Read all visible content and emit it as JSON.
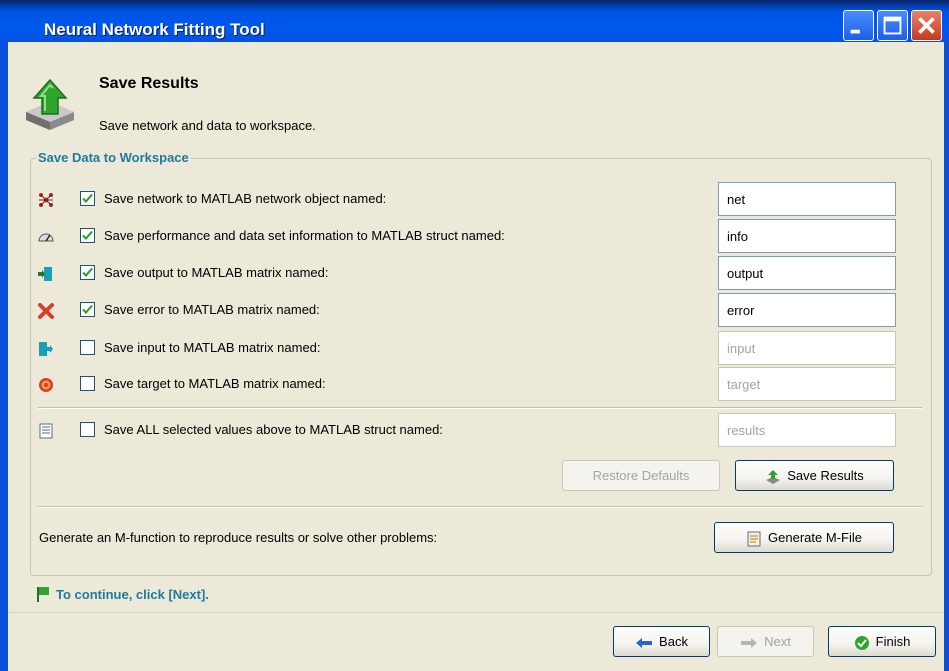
{
  "window": {
    "title": "Neural Network Fitting Tool"
  },
  "header": {
    "title": "Save Results",
    "subtitle": "Save network and data to workspace."
  },
  "group": {
    "legend": "Save Data to Workspace",
    "rows": [
      {
        "icon": "network-icon",
        "checked": true,
        "label": "Save network to MATLAB network object named:",
        "value": "net",
        "enabled": true
      },
      {
        "icon": "performance-icon",
        "checked": true,
        "label": "Save performance and data set information to MATLAB struct named:",
        "value": "info",
        "enabled": true
      },
      {
        "icon": "output-icon",
        "checked": true,
        "label": "Save output to MATLAB matrix named:",
        "value": "output",
        "enabled": true
      },
      {
        "icon": "error-icon",
        "checked": true,
        "label": "Save error to MATLAB matrix named:",
        "value": "error",
        "enabled": true
      },
      {
        "icon": "input-icon",
        "checked": false,
        "label": "Save input to MATLAB matrix named:",
        "value": "input",
        "enabled": false
      },
      {
        "icon": "target-icon",
        "checked": false,
        "label": "Save target to MATLAB matrix named:",
        "value": "target",
        "enabled": false
      }
    ],
    "all_row": {
      "icon": "document-icon",
      "checked": false,
      "label": "Save ALL selected values above to MATLAB struct named:",
      "value": "results",
      "enabled": false
    },
    "restore_defaults": "Restore Defaults",
    "save_results": "Save Results",
    "generate_text": "Generate an M-function to reproduce results or solve other problems:",
    "generate_button": "Generate M-File"
  },
  "footer": {
    "continue_text": "To continue, click [Next].",
    "back": "Back",
    "next": "Next",
    "finish": "Finish"
  },
  "colors": {
    "accent_text": "#1f7a9e",
    "title_bar": "#0054e3"
  }
}
